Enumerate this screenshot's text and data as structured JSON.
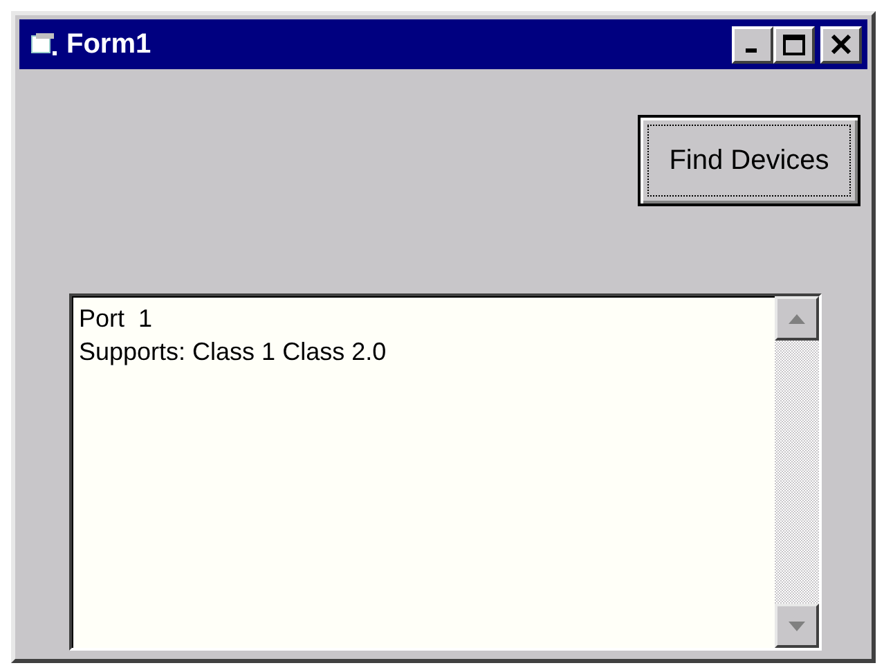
{
  "window": {
    "title": "Form1"
  },
  "buttons": [
    {
      "label": "Find Devices",
      "focused": true
    }
  ],
  "output_list": {
    "lines": [
      "Port  1",
      "Supports: Class 1 Class 2.0"
    ]
  }
}
